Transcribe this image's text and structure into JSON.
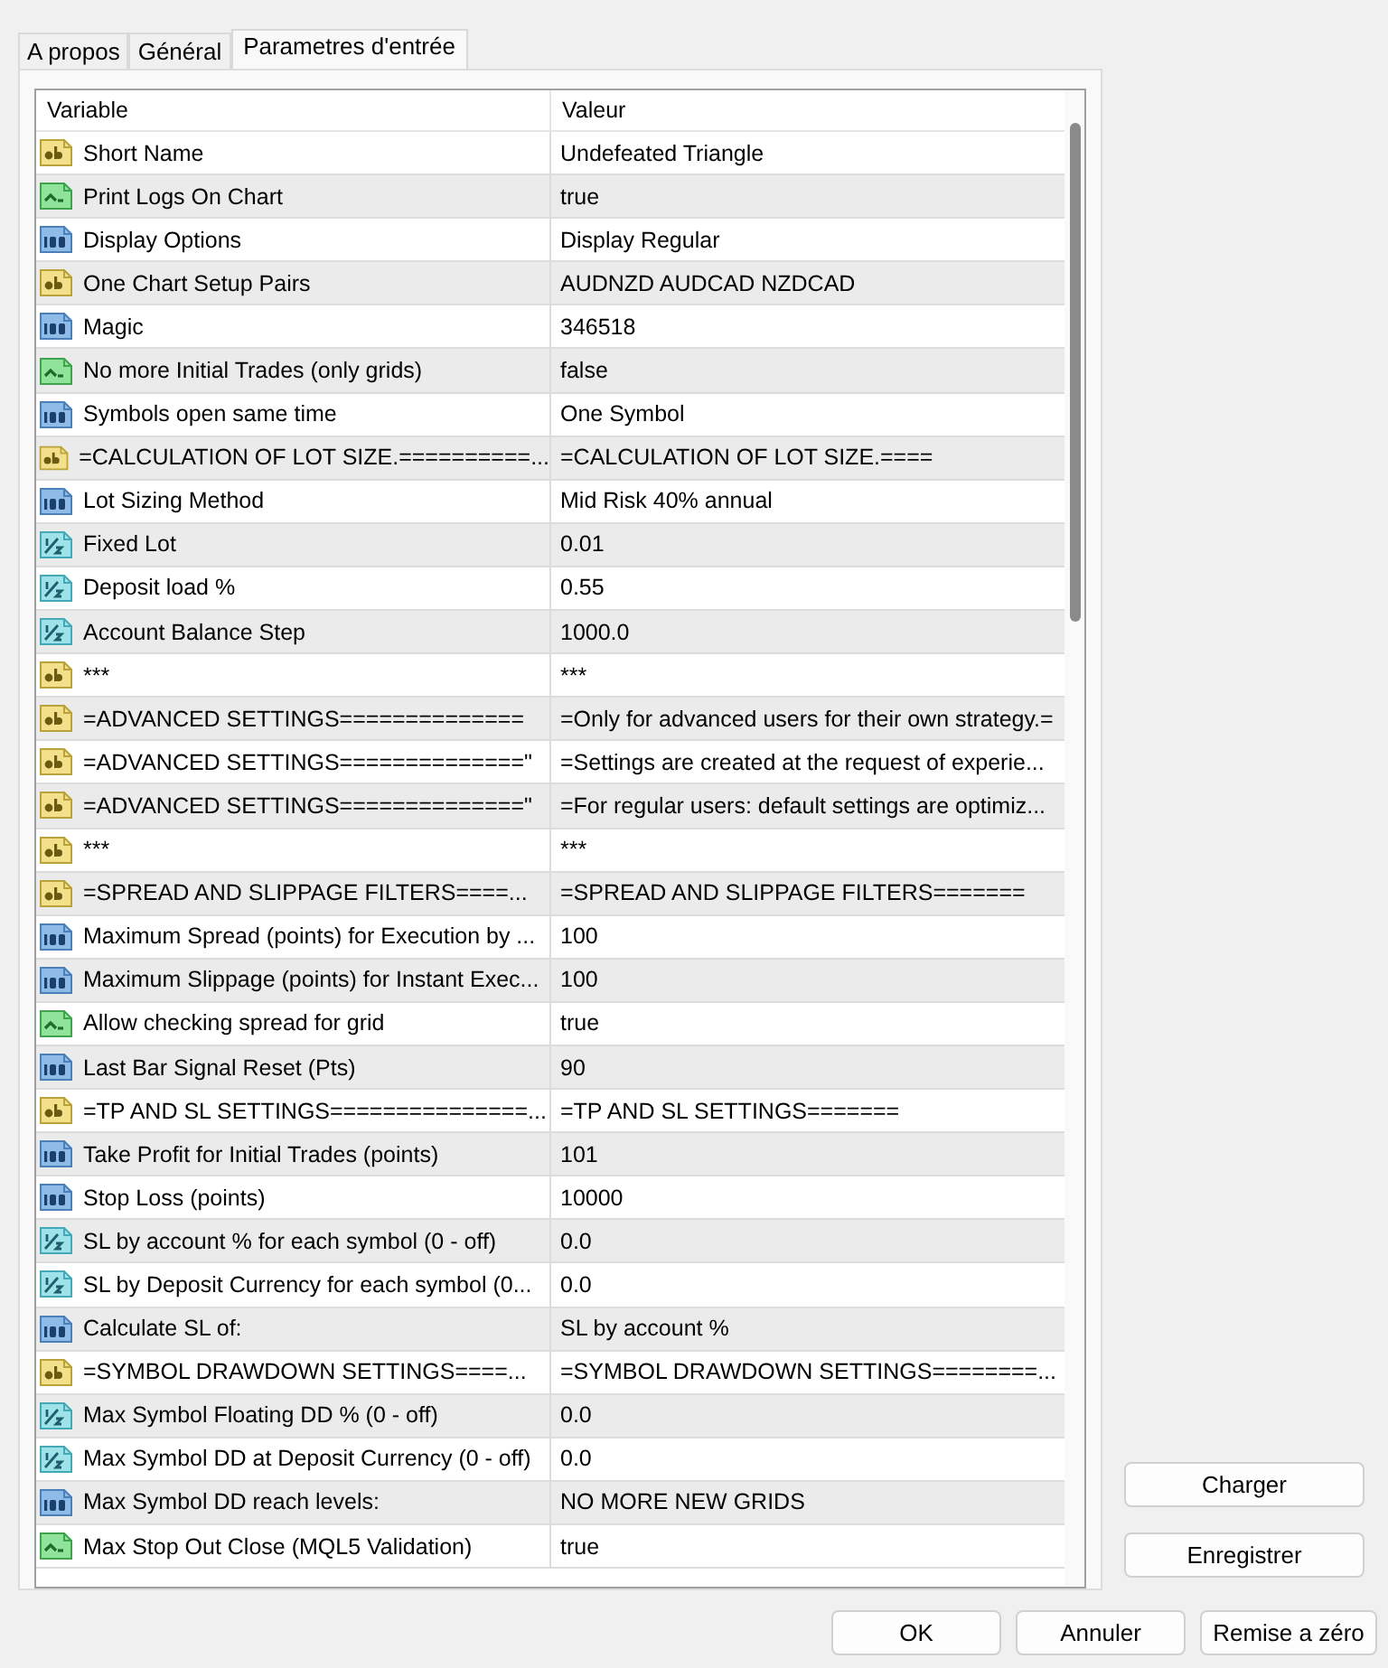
{
  "tabs": [
    {
      "label": "A propos",
      "selected": false
    },
    {
      "label": "Général",
      "selected": false
    },
    {
      "label": "Parametres d'entrée",
      "selected": true
    }
  ],
  "table": {
    "columns": [
      "Variable",
      "Valeur"
    ],
    "rows": [
      {
        "kind": "string",
        "variable": "Short Name",
        "value": "Undefeated Triangle"
      },
      {
        "kind": "bool",
        "variable": "Print Logs On Chart",
        "value": "true"
      },
      {
        "kind": "int",
        "variable": "Display Options",
        "value": "Display Regular"
      },
      {
        "kind": "string",
        "variable": "One Chart Setup Pairs",
        "value": "AUDNZD AUDCAD NZDCAD"
      },
      {
        "kind": "int",
        "variable": "Magic",
        "value": "346518"
      },
      {
        "kind": "bool",
        "variable": "No more Initial Trades (only grids)",
        "value": "false"
      },
      {
        "kind": "int",
        "variable": "Symbols open same time",
        "value": "One Symbol"
      },
      {
        "kind": "string",
        "variable": "=CALCULATION OF LOT SIZE.==========...",
        "value": "=CALCULATION OF LOT SIZE.===="
      },
      {
        "kind": "int",
        "variable": "Lot Sizing Method",
        "value": "Mid Risk 40% annual"
      },
      {
        "kind": "double",
        "variable": "Fixed Lot",
        "value": "0.01"
      },
      {
        "kind": "double",
        "variable": "Deposit load %",
        "value": "0.55"
      },
      {
        "kind": "double",
        "variable": "Account Balance Step",
        "value": "1000.0"
      },
      {
        "kind": "string",
        "variable": "***",
        "value": "***"
      },
      {
        "kind": "string",
        "variable": "=ADVANCED SETTINGS==============",
        "value": "=Only for advanced users for their own strategy.="
      },
      {
        "kind": "string",
        "variable": "=ADVANCED SETTINGS==============\"",
        "value": "=Settings are created at the request of experie..."
      },
      {
        "kind": "string",
        "variable": "=ADVANCED SETTINGS==============\"",
        "value": "=For regular users: default settings are optimiz..."
      },
      {
        "kind": "string",
        "variable": "***",
        "value": "***"
      },
      {
        "kind": "string",
        "variable": "=SPREAD AND SLIPPAGE FILTERS====...",
        "value": "=SPREAD AND SLIPPAGE FILTERS======="
      },
      {
        "kind": "int",
        "variable": "Maximum Spread (points) for Execution by ...",
        "value": "100"
      },
      {
        "kind": "int",
        "variable": "Maximum Slippage (points) for Instant Exec...",
        "value": "100"
      },
      {
        "kind": "bool",
        "variable": "Allow checking spread for grid",
        "value": "true"
      },
      {
        "kind": "int",
        "variable": "Last Bar Signal Reset (Pts)",
        "value": "90"
      },
      {
        "kind": "string",
        "variable": "=TP AND SL SETTINGS===============...",
        "value": "=TP AND SL SETTINGS======="
      },
      {
        "kind": "int",
        "variable": "Take Profit for Initial Trades (points)",
        "value": "101"
      },
      {
        "kind": "int",
        "variable": "Stop Loss (points)",
        "value": "10000"
      },
      {
        "kind": "double",
        "variable": "SL by account % for each symbol (0 - off)",
        "value": "0.0"
      },
      {
        "kind": "double",
        "variable": "SL by Deposit Currency for each symbol (0...",
        "value": "0.0"
      },
      {
        "kind": "int",
        "variable": "Calculate SL of:",
        "value": "SL by account %"
      },
      {
        "kind": "string",
        "variable": "=SYMBOL DRAWDOWN SETTINGS====...",
        "value": "=SYMBOL DRAWDOWN SETTINGS========..."
      },
      {
        "kind": "double",
        "variable": "Max Symbol Floating DD % (0 - off)",
        "value": "0.0"
      },
      {
        "kind": "double",
        "variable": "Max Symbol DD at Deposit Currency (0 - off)",
        "value": "0.0"
      },
      {
        "kind": "int",
        "variable": "Max Symbol DD reach levels:",
        "value": "NO MORE NEW GRIDS"
      },
      {
        "kind": "bool",
        "variable": "Max Stop Out Close (MQL5 Validation)",
        "value": "true"
      }
    ]
  },
  "side_buttons": [
    "Charger",
    "Enregistrer"
  ],
  "buttons": [
    "OK",
    "Annuler",
    "Remise a zéro"
  ]
}
